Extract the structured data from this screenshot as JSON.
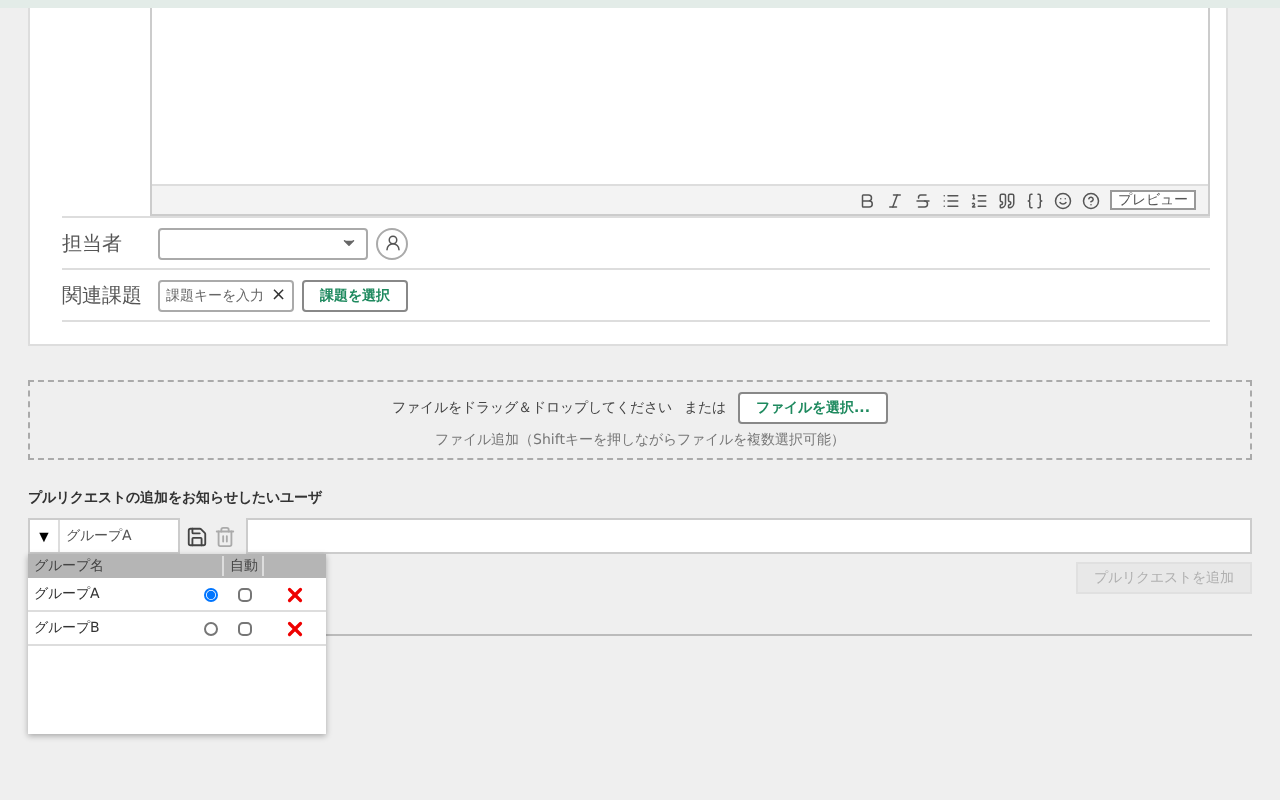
{
  "editor": {
    "toolbar": [
      {
        "kind": "bold"
      },
      {
        "kind": "italic"
      },
      {
        "kind": "strike"
      },
      {
        "kind": "list"
      },
      {
        "kind": "ordered"
      },
      {
        "kind": "quote"
      },
      {
        "kind": "code"
      },
      {
        "kind": "emoji"
      },
      {
        "kind": "help"
      }
    ],
    "preview": "プレビュー"
  },
  "fields": [
    {
      "kind": "select",
      "label": "担当者"
    },
    {
      "kind": "issue",
      "label": "関連課題",
      "placeholder": "課題キーを入力",
      "clear": "×",
      "button": "課題を選択"
    }
  ],
  "upload": {
    "text": "ファイルをドラッグ＆ドロップしてください",
    "or": "または",
    "button": "ファイルを選択...",
    "hint": "ファイル追加（Shiftキーを押しながらファイルを複数選択可能）"
  },
  "notify": {
    "title": "プルリクエストの追加をお知らせしたいユーザ",
    "toggle": "▼",
    "group_value": "グループA",
    "columns": [
      "グループ名",
      "自動"
    ],
    "groups": [
      {
        "name": "グループA",
        "selected": true,
        "checked": false
      },
      {
        "name": "グループB",
        "selected": false,
        "checked": false
      }
    ],
    "submit": {
      "label": "プルリクエストを追加",
      "disabled": true
    }
  }
}
